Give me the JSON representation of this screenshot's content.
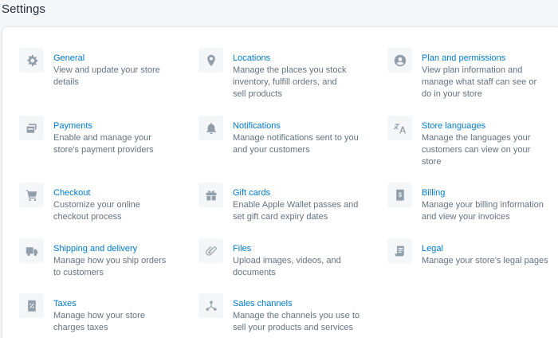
{
  "page": {
    "title": "Settings"
  },
  "items": {
    "general": {
      "title": "General",
      "desc": "View and update your store details"
    },
    "locations": {
      "title": "Locations",
      "desc": "Manage the places you stock inventory, fulfill orders, and sell products"
    },
    "plan": {
      "title": "Plan and permissions",
      "desc": "View plan information and manage what staff can see or do in your store"
    },
    "payments": {
      "title": "Payments",
      "desc": "Enable and manage your store's payment providers"
    },
    "notifications": {
      "title": "Notifications",
      "desc": "Manage notifications sent to you and your customers"
    },
    "languages": {
      "title": "Store languages",
      "desc": "Manage the languages your customers can view on your store"
    },
    "checkout": {
      "title": "Checkout",
      "desc": "Customize your online checkout process"
    },
    "giftcards": {
      "title": "Gift cards",
      "desc": "Enable Apple Wallet passes and set gift card expiry dates"
    },
    "billing": {
      "title": "Billing",
      "desc": "Manage your billing information and view your invoices"
    },
    "shipping": {
      "title": "Shipping and delivery",
      "desc": "Manage how you ship orders to customers"
    },
    "files": {
      "title": "Files",
      "desc": "Upload images, videos, and documents"
    },
    "legal": {
      "title": "Legal",
      "desc": "Manage your store's legal pages"
    },
    "taxes": {
      "title": "Taxes",
      "desc": "Manage how your store charges taxes"
    },
    "channels": {
      "title": "Sales channels",
      "desc": "Manage the channels you use to sell your products and services"
    }
  },
  "icons": {
    "general": "gear-icon",
    "locations": "location-pin-icon",
    "plan": "user-circle-icon",
    "payments": "credit-card-icon",
    "notifications": "bell-icon",
    "languages": "translate-icon",
    "checkout": "cart-icon",
    "giftcards": "gift-icon",
    "billing": "bill-icon",
    "shipping": "truck-icon",
    "files": "paperclip-icon",
    "legal": "document-icon",
    "taxes": "tax-icon",
    "channels": "channels-icon"
  },
  "colors": {
    "link": "#007ace",
    "text": "#637381",
    "icon": "#919eab",
    "iconBg": "#f4f6f8"
  }
}
